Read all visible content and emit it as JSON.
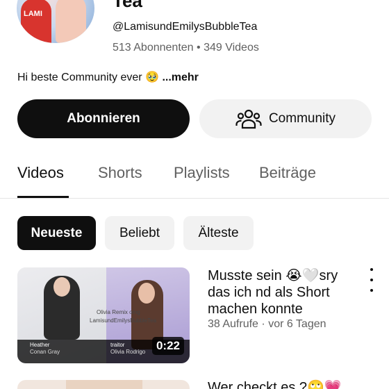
{
  "channel": {
    "title": "Tea",
    "handle": "@LamisundEmilysBubbleTea",
    "subscribers": "513 Abonnenten",
    "videos_count": "349 Videos",
    "separator": "•",
    "description": "Hi beste Community ever 🥹",
    "more_label": "...mehr",
    "avatar_text": "LAMI"
  },
  "buttons": {
    "subscribe": "Abonnieren",
    "community": "Community",
    "community_icon": "people-icon"
  },
  "tabs": [
    {
      "label": "Videos",
      "active": true
    },
    {
      "label": "Shorts",
      "active": false
    },
    {
      "label": "Playlists",
      "active": false
    },
    {
      "label": "Beiträge",
      "active": false
    }
  ],
  "chips": [
    {
      "label": "Neueste",
      "active": true
    },
    {
      "label": "Beliebt",
      "active": false
    },
    {
      "label": "Älteste",
      "active": false
    }
  ],
  "videos": [
    {
      "title": "Musste sein 😭🤍sry das ich nd als Short machen konnte",
      "views": "38 Aufrufe",
      "age": "vor 6 Tagen",
      "meta_separator": "·",
      "duration": "0:22",
      "thumb_text": {
        "left_song": "Heather",
        "left_artist": "Conan Gray",
        "right_song": "traitor",
        "right_artist": "Olivia Rodrigo",
        "center": "Olivia Remix omg",
        "handle_overlay": "LamisundEmilysBubbleTea"
      }
    },
    {
      "title": "Wer checkt es ?🙄💗"
    }
  ],
  "colors": {
    "text_primary": "#0f0f0f",
    "text_secondary": "#606060",
    "chip_bg": "#f2f2f2",
    "subscribe_bg": "#0f0f0f"
  }
}
